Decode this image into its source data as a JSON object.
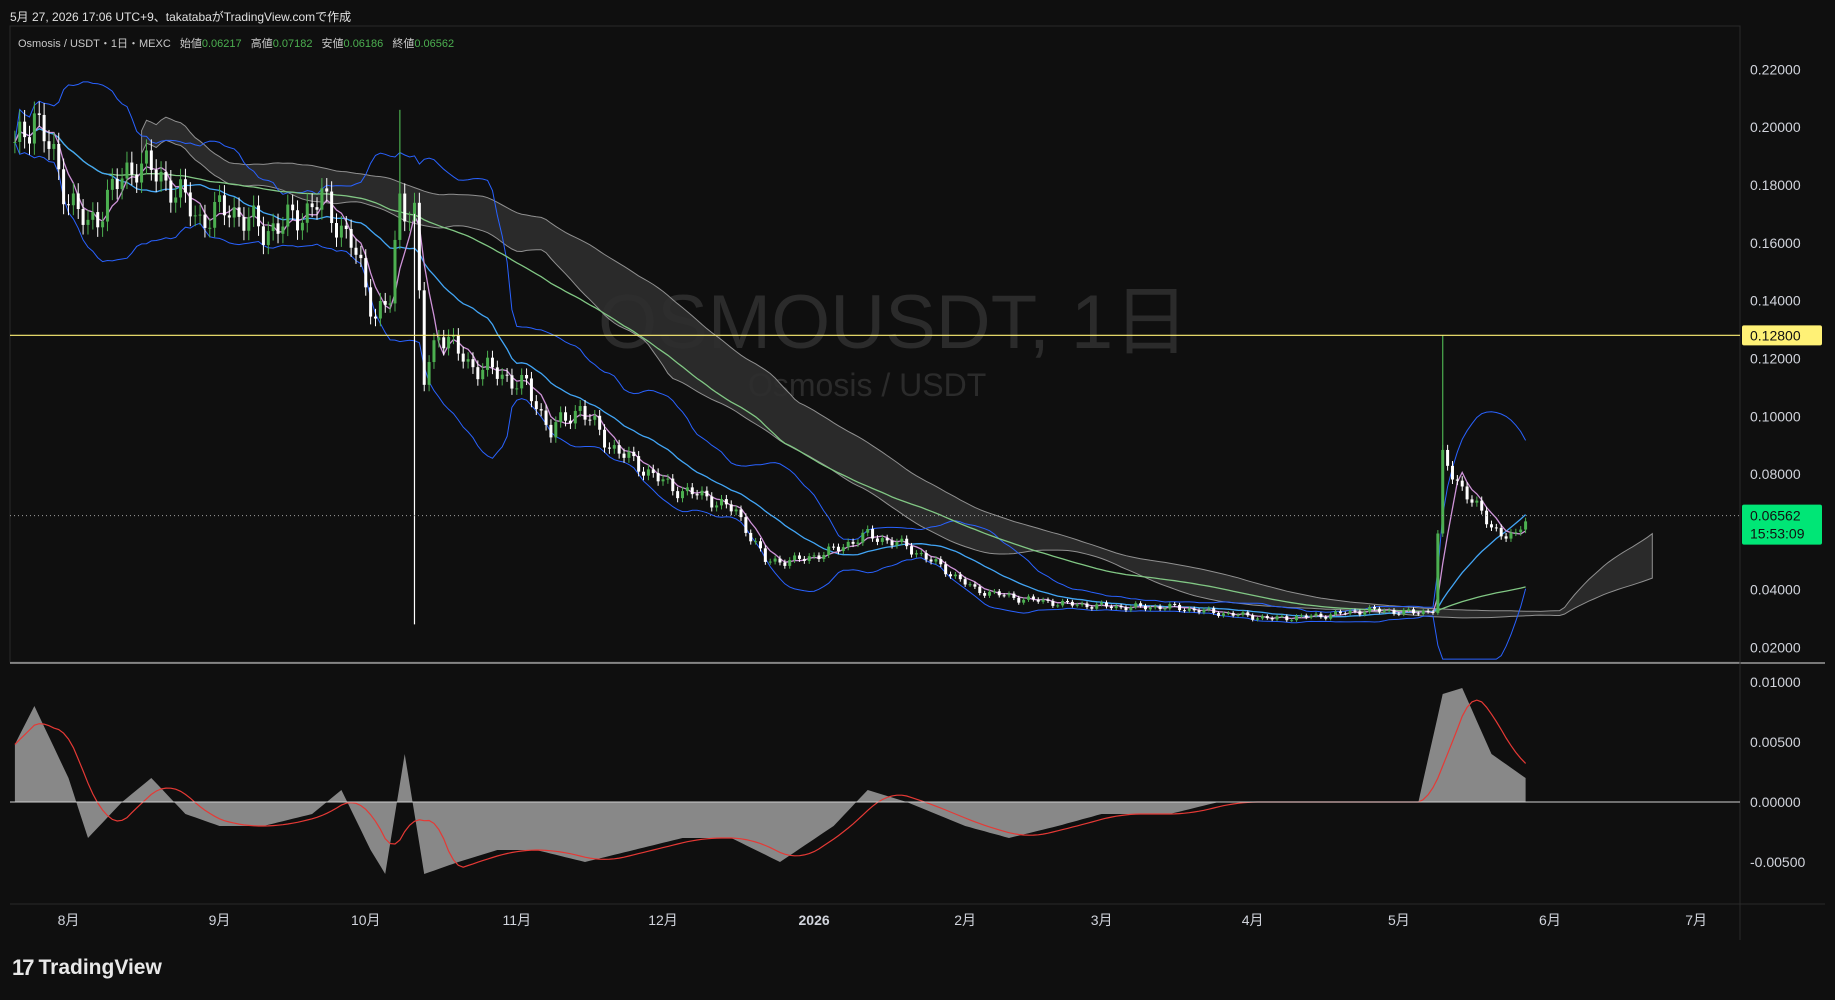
{
  "header": {
    "caption": "5月 27, 2026 17:06 UTC+9、takatabaがTradingView.comで作成"
  },
  "legend": {
    "symbol_line": "Osmosis / USDT・1日・MEXC",
    "open_label": "始値",
    "open_value": "0.06217",
    "high_label": "高値",
    "high_value": "0.07182",
    "low_label": "安値",
    "low_value": "0.06186",
    "close_label": "終値",
    "close_value": "0.06562"
  },
  "watermark": {
    "ticker": "OSMOUSDT, 1日",
    "name": "Osmosis / USDT"
  },
  "price_axis": {
    "ticks": [
      "0.22000",
      "0.20000",
      "0.18000",
      "0.16000",
      "0.14000",
      "0.12000",
      "0.10000",
      "0.08000",
      "0.06000",
      "0.04000",
      "0.02000"
    ],
    "tick_values": [
      0.22,
      0.2,
      0.18,
      0.16,
      0.14,
      0.12,
      0.1,
      0.08,
      0.06,
      0.04,
      0.02
    ],
    "horizontal_line_label": "0.12800",
    "horizontal_line_value": 0.128,
    "last_price_label": "0.06562",
    "countdown": "15:53:09"
  },
  "osc_axis": {
    "ticks": [
      "0.01000",
      "0.00500",
      "0.00000",
      "-0.00500"
    ],
    "tick_values": [
      0.01,
      0.005,
      0.0,
      -0.005
    ]
  },
  "time_axis": {
    "labels": [
      "8月",
      "9月",
      "10月",
      "11月",
      "12月",
      "2026",
      "2月",
      "3月",
      "4月",
      "5月",
      "6月",
      "7月"
    ],
    "bold_label": "2026"
  },
  "colors": {
    "background": "#0f0f0f",
    "up_candle": "#4caf50",
    "down_candle": "#ffffff",
    "ma_short": "#ce93d8",
    "ma_mid": "#42a5f5",
    "ma_long": "#81c784",
    "bollinger": "#2962ff",
    "cloud": "#9e9e9e",
    "hline": "#fff176",
    "price_tag": "#00e676",
    "osc_fill": "#9e9e9e",
    "osc_signal": "#e53935"
  },
  "chart_data": {
    "type": "candlestick",
    "title": "OSMOUSDT, 1日",
    "x_range": [
      "2025-07-20",
      "2026-07-10"
    ],
    "ylim": [
      0.015,
      0.235
    ],
    "price_path": [
      [
        "2025-07-21",
        0.192
      ],
      [
        "2025-07-25",
        0.205
      ],
      [
        "2025-08-01",
        0.176
      ],
      [
        "2025-08-05",
        0.165
      ],
      [
        "2025-08-10",
        0.178
      ],
      [
        "2025-08-15",
        0.188
      ],
      [
        "2025-08-22",
        0.18
      ],
      [
        "2025-08-28",
        0.168
      ],
      [
        "2025-09-03",
        0.172
      ],
      [
        "2025-09-10",
        0.164
      ],
      [
        "2025-09-16",
        0.168
      ],
      [
        "2025-09-22",
        0.175
      ],
      [
        "2025-09-28",
        0.16
      ],
      [
        "2025-10-03",
        0.135
      ],
      [
        "2025-10-06",
        0.14
      ],
      [
        "2025-10-08",
        0.175
      ],
      [
        "2025-10-11",
        0.17
      ],
      [
        "2025-10-13",
        0.112
      ],
      [
        "2025-10-16",
        0.13
      ],
      [
        "2025-10-22",
        0.118
      ],
      [
        "2025-10-28",
        0.115
      ],
      [
        "2025-11-03",
        0.11
      ],
      [
        "2025-11-08",
        0.095
      ],
      [
        "2025-11-14",
        0.103
      ],
      [
        "2025-11-20",
        0.09
      ],
      [
        "2025-11-26",
        0.083
      ],
      [
        "2025-12-03",
        0.075
      ],
      [
        "2025-12-10",
        0.072
      ],
      [
        "2025-12-16",
        0.067
      ],
      [
        "2025-12-22",
        0.05
      ],
      [
        "2025-12-28",
        0.05
      ],
      [
        "2026-01-04",
        0.053
      ],
      [
        "2026-01-12",
        0.059
      ],
      [
        "2026-01-20",
        0.055
      ],
      [
        "2026-01-27",
        0.048
      ],
      [
        "2026-02-03",
        0.04
      ],
      [
        "2026-02-12",
        0.037
      ],
      [
        "2026-02-22",
        0.035
      ],
      [
        "2026-03-05",
        0.034
      ],
      [
        "2026-03-15",
        0.034
      ],
      [
        "2026-03-25",
        0.032
      ],
      [
        "2026-04-05",
        0.03
      ],
      [
        "2026-04-15",
        0.031
      ],
      [
        "2026-04-25",
        0.033
      ],
      [
        "2026-05-05",
        0.032
      ],
      [
        "2026-05-08",
        0.033
      ],
      [
        "2026-05-10",
        0.085
      ],
      [
        "2026-05-12",
        0.08
      ],
      [
        "2026-05-15",
        0.073
      ],
      [
        "2026-05-18",
        0.066
      ],
      [
        "2026-05-22",
        0.059
      ],
      [
        "2026-05-25",
        0.058
      ],
      [
        "2026-05-27",
        0.06562
      ]
    ],
    "spike_highs": [
      [
        "2025-10-08",
        0.206
      ],
      [
        "2026-05-10",
        0.128
      ]
    ],
    "spike_lows": [
      [
        "2025-10-11",
        0.028
      ]
    ],
    "oscillator": {
      "ylim": [
        -0.0085,
        0.0115
      ],
      "values": [
        [
          "2025-07-20",
          0.004
        ],
        [
          "2025-07-25",
          0.008
        ],
        [
          "2025-08-01",
          0.002
        ],
        [
          "2025-08-05",
          -0.003
        ],
        [
          "2025-08-12",
          0.0
        ],
        [
          "2025-08-18",
          0.002
        ],
        [
          "2025-08-25",
          -0.001
        ],
        [
          "2025-09-01",
          -0.002
        ],
        [
          "2025-09-10",
          -0.002
        ],
        [
          "2025-09-20",
          -0.001
        ],
        [
          "2025-09-26",
          0.001
        ],
        [
          "2025-10-02",
          -0.004
        ],
        [
          "2025-10-05",
          -0.006
        ],
        [
          "2025-10-09",
          0.004
        ],
        [
          "2025-10-13",
          -0.006
        ],
        [
          "2025-10-20",
          -0.005
        ],
        [
          "2025-10-28",
          -0.004
        ],
        [
          "2025-11-05",
          -0.004
        ],
        [
          "2025-11-15",
          -0.005
        ],
        [
          "2025-11-25",
          -0.004
        ],
        [
          "2025-12-05",
          -0.003
        ],
        [
          "2025-12-15",
          -0.003
        ],
        [
          "2025-12-25",
          -0.005
        ],
        [
          "2026-01-05",
          -0.002
        ],
        [
          "2026-01-12",
          0.001
        ],
        [
          "2026-01-20",
          0.0
        ],
        [
          "2026-02-01",
          -0.002
        ],
        [
          "2026-02-10",
          -0.003
        ],
        [
          "2026-02-20",
          -0.002
        ],
        [
          "2026-03-01",
          -0.001
        ],
        [
          "2026-03-15",
          -0.001
        ],
        [
          "2026-03-25",
          0.0
        ],
        [
          "2026-04-05",
          0.0
        ],
        [
          "2026-04-20",
          0.0
        ],
        [
          "2026-05-05",
          0.0
        ],
        [
          "2026-05-10",
          0.009
        ],
        [
          "2026-05-14",
          0.0095
        ],
        [
          "2026-05-20",
          0.004
        ],
        [
          "2026-05-27",
          0.002
        ]
      ]
    }
  }
}
